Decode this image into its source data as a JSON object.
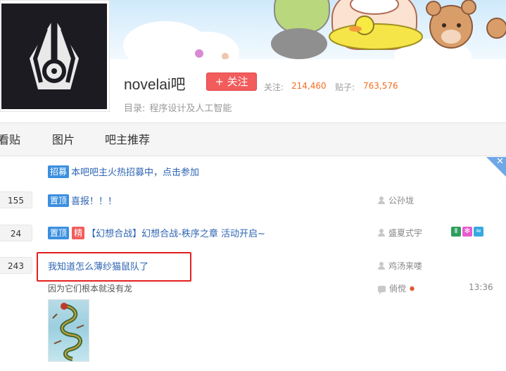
{
  "forum": {
    "name": "novelai吧",
    "follow_label": "+ 关注",
    "follow_count_label": "关注:",
    "follow_count": "214,460",
    "post_count_label": "贴子:",
    "post_count": "763,576",
    "catalog_label": "目录:",
    "catalog_value": "程序设计及人工智能"
  },
  "tabs": [
    {
      "label": "看贴"
    },
    {
      "label": "图片"
    },
    {
      "label": "吧主推荐"
    }
  ],
  "threads": [
    {
      "tags": [
        "招募"
      ],
      "title": "本吧吧主火热招募中，点击参加"
    },
    {
      "reply_count": "155",
      "tags": [
        "置顶"
      ],
      "title": "喜报！！！",
      "author": "公孙垅"
    },
    {
      "reply_count": "24",
      "tags": [
        "置顶",
        "精"
      ],
      "title": "【幻想合战】幻想合战-秩序之章 活动开启~",
      "author": "盛夏式宇"
    },
    {
      "reply_count": "243",
      "title": "我知道怎么薄纱猫鼠队了",
      "author": "鸡汤来喽",
      "abstract": "因为它们根本就没有龙",
      "last_reply_user": "倘傥",
      "last_reply_time": "13:36"
    }
  ],
  "colors": {
    "link": "#2d64b3",
    "tag_blue": "#3a8fdf",
    "tag_red": "#f35c5c",
    "count_orange": "#f36c21",
    "highlight": "#e2201e"
  },
  "icons": [
    "novelai-pen-logo",
    "person-icon",
    "reply-icon",
    "close-icon",
    "maple-leaf-icon"
  ]
}
